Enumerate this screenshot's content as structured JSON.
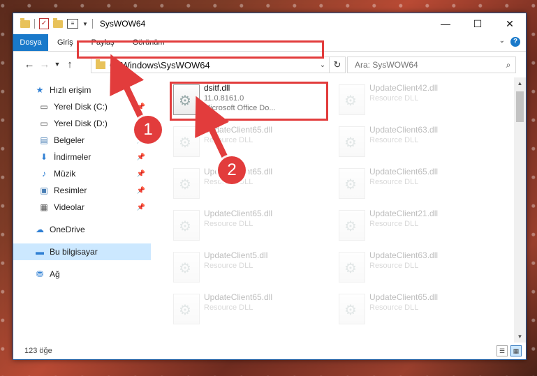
{
  "window": {
    "title": "SysWOW64"
  },
  "ribbon": {
    "file_tab": "Dosya",
    "tabs": [
      "Giriş",
      "Paylaş",
      "Görünüm"
    ]
  },
  "nav": {
    "address": "C:\\Windows\\SysWOW64",
    "search_placeholder": "Ara: SysWOW64"
  },
  "sidebar": {
    "quick_access": "Hızlı erişim",
    "items": [
      {
        "label": "Yerel Disk (C:)",
        "icon": "drive-icon",
        "pinned": true
      },
      {
        "label": "Yerel Disk (D:)",
        "icon": "drive-icon",
        "pinned": false
      },
      {
        "label": "Belgeler",
        "icon": "documents-icon",
        "pinned": true
      },
      {
        "label": "İndirmeler",
        "icon": "download-icon",
        "pinned": true
      },
      {
        "label": "Müzik",
        "icon": "music-icon",
        "pinned": true
      },
      {
        "label": "Resimler",
        "icon": "pictures-icon",
        "pinned": true
      },
      {
        "label": "Videolar",
        "icon": "videos-icon",
        "pinned": true
      }
    ],
    "onedrive": "OneDrive",
    "this_pc": "Bu bilgisayar",
    "network": "Ağ"
  },
  "files": [
    {
      "name": "dsitf.dll",
      "version": "11.0.8161.0",
      "desc": "Microsoft Office Do..."
    },
    {
      "name": "UpdateClient42.dll",
      "desc": "Resource DLL"
    },
    {
      "name": "UpdateClient65.dll",
      "desc": "Resource DLL"
    },
    {
      "name": "UpdateClient63.dll",
      "desc": "Resource DLL"
    },
    {
      "name": "UpdateClient65.dll",
      "desc": "Resource DLL"
    },
    {
      "name": "UpdateClient65.dll",
      "desc": "Resource DLL"
    },
    {
      "name": "UpdateClient65.dll",
      "desc": "Resource DLL"
    },
    {
      "name": "UpdateClient21.dll",
      "desc": "Resource DLL"
    },
    {
      "name": "UpdateClient5.dll",
      "desc": "Resource DLL"
    },
    {
      "name": "UpdateClient63.dll",
      "desc": "Resource DLL"
    },
    {
      "name": "UpdateClient65.dll",
      "desc": "Resource DLL"
    },
    {
      "name": "UpdateClient65.dll",
      "desc": "Resource DLL"
    }
  ],
  "status": {
    "count": "123 öğe"
  },
  "annotations": {
    "step1": "1",
    "step2": "2"
  },
  "colors": {
    "accent": "#1979ca",
    "highlight": "#e23c3c",
    "selected": "#cce8ff"
  }
}
